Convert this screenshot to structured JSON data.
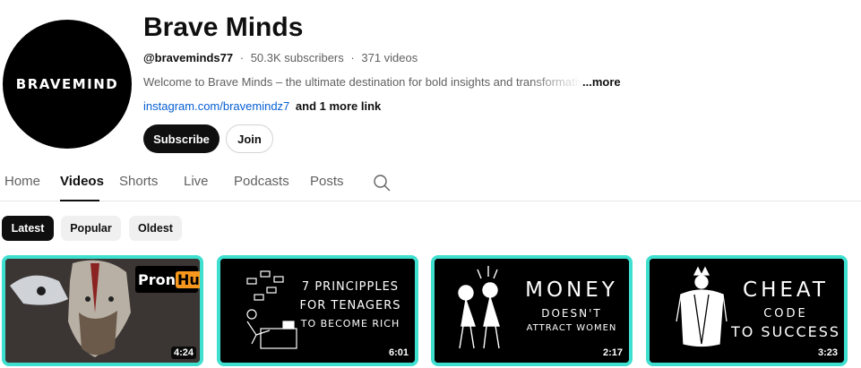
{
  "channel": {
    "logo_text": "BRAVEMIND",
    "title": "Brave Minds",
    "handle": "@braveminds77",
    "subscribers": "50.3K subscribers",
    "video_count": "371 videos",
    "description": "Welcome to Brave Minds – the ultimate destination for bold insights and transformative growth",
    "more_label": "...more",
    "link_url": "instagram.com/bravemindz7",
    "link_more": "and 1 more link",
    "subscribe_label": "Subscribe",
    "join_label": "Join",
    "separator": "·"
  },
  "tabs": [
    {
      "label": "Home"
    },
    {
      "label": "Videos"
    },
    {
      "label": "Shorts"
    },
    {
      "label": "Live"
    },
    {
      "label": "Podcasts"
    },
    {
      "label": "Posts"
    }
  ],
  "active_tab": "Videos",
  "filters": [
    {
      "label": "Latest"
    },
    {
      "label": "Popular"
    },
    {
      "label": "Oldest"
    }
  ],
  "videos": [
    {
      "thumb_text": "PornHub",
      "thumb_text_a": "Pron",
      "thumb_text_b": "Hub",
      "duration": "4:24"
    },
    {
      "thumb_line1": "7 PRINCIPPLES",
      "thumb_line2": "FOR TENAGERS",
      "thumb_line3": "TO BECOME RICH",
      "duration": "6:01"
    },
    {
      "thumb_line1": "MONEY",
      "thumb_line2": "DOESN'T",
      "thumb_line3": "ATTRACT WOMEN",
      "duration": "2:17"
    },
    {
      "thumb_line1": "CHEAT",
      "thumb_line2": "CODE",
      "thumb_line3": "TO SUCCESS",
      "duration": "3:23"
    }
  ],
  "colors": {
    "accent_border": "#3fdfd0",
    "link": "#065fd4",
    "primary_button": "#0f0f0f"
  },
  "icons": [
    "search-icon"
  ]
}
